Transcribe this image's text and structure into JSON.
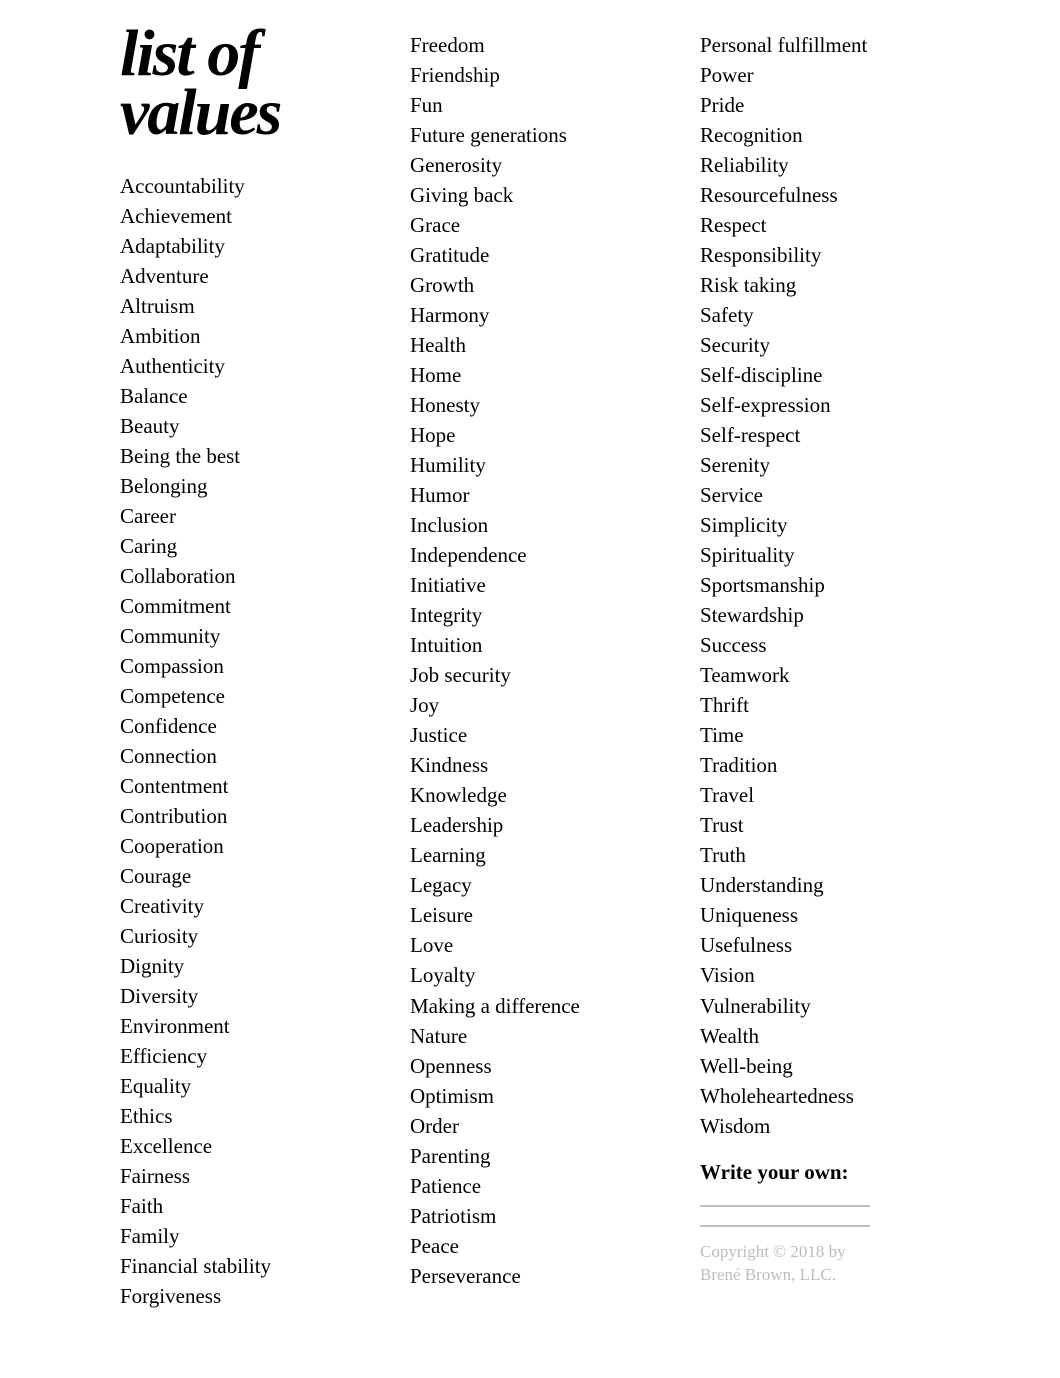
{
  "title_line1": "list of",
  "title_line2": "values",
  "values": [
    "Accountability",
    "Achievement",
    "Adaptability",
    "Adventure",
    "Altruism",
    "Ambition",
    "Authenticity",
    "Balance",
    "Beauty",
    "Being the best",
    "Belonging",
    "Career",
    "Caring",
    "Collaboration",
    "Commitment",
    "Community",
    "Compassion",
    "Competence",
    "Confidence",
    "Connection",
    "Contentment",
    "Contribution",
    "Cooperation",
    "Courage",
    "Creativity",
    "Curiosity",
    "Dignity",
    "Diversity",
    "Environment",
    "Efficiency",
    "Equality",
    "Ethics",
    "Excellence",
    "Fairness",
    "Faith",
    "Family",
    "Financial stability",
    "Forgiveness",
    "Freedom",
    "Friendship",
    "Fun",
    "Future generations",
    "Generosity",
    "Giving back",
    "Grace",
    "Gratitude",
    "Growth",
    "Harmony",
    "Health",
    "Home",
    "Honesty",
    "Hope",
    "Humility",
    "Humor",
    "Inclusion",
    "Independence",
    "Initiative",
    "Integrity",
    "Intuition",
    "Job security",
    "Joy",
    "Justice",
    "Kindness",
    "Knowledge",
    "Leadership",
    "Learning",
    "Legacy",
    "Leisure",
    "Love",
    "Loyalty",
    "Making a difference",
    "Nature",
    "Openness",
    "Optimism",
    "Order",
    "Parenting",
    "Patience",
    "Patriotism",
    "Peace",
    "Perseverance",
    "Personal fulfillment",
    "Power",
    "Pride",
    "Recognition",
    "Reliability",
    "Resourcefulness",
    "Respect",
    "Responsibility",
    "Risk taking",
    "Safety",
    "Security",
    "Self-discipline",
    "Self-expression",
    "Self-respect",
    "Serenity",
    "Service",
    "Simplicity",
    "Spirituality",
    "Sportsmanship",
    "Stewardship",
    "Success",
    "Teamwork",
    "Thrift",
    "Time",
    "Tradition",
    "Travel",
    "Trust",
    "Truth",
    "Understanding",
    "Uniqueness",
    "Usefulness",
    "Vision",
    "Vulnerability",
    "Wealth",
    "Well-being",
    "Wholeheartedness",
    "Wisdom"
  ],
  "write_your_own": "Write your own:",
  "copyright_line1": "Copyright © 2018 by",
  "copyright_line2": "Brené Brown, LLC."
}
